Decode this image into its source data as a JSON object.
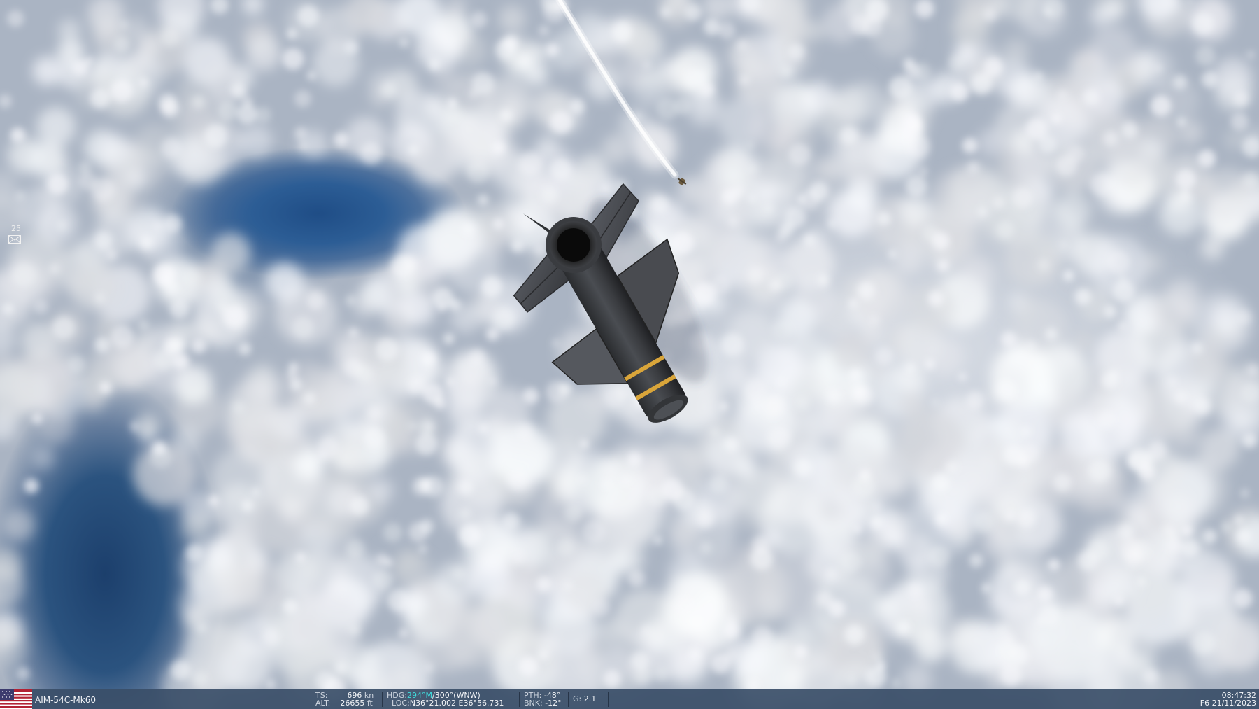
{
  "notifications": {
    "count": "25",
    "icon": "envelope-icon"
  },
  "status_bar": {
    "flag_icon": "us-flag-icon",
    "unit_name": "AIM-54C-Mk60",
    "ts_label": "TS:",
    "ts_value": "696",
    "ts_unit": "kn",
    "alt_label": "ALT:",
    "alt_value": "26655",
    "alt_unit": "ft",
    "hdg_label": "HDG:",
    "hdg_mag": "294°M",
    "hdg_true": "/300°(WNW)",
    "loc_label": "LOC:",
    "loc_value": "N36°21.002 E36°56.731",
    "pth_label": "PTH:",
    "pth_value": "-48°",
    "bnk_label": "BNK:",
    "bnk_value": "-12°",
    "g_label": "G:",
    "g_value": "2.1",
    "time": "08:47:32",
    "date": "F6 21/11/2023"
  },
  "colors": {
    "hud_background": "#3a4e68",
    "heading_highlight": "#3fe0e0",
    "missile_band": "#d9a53a"
  }
}
